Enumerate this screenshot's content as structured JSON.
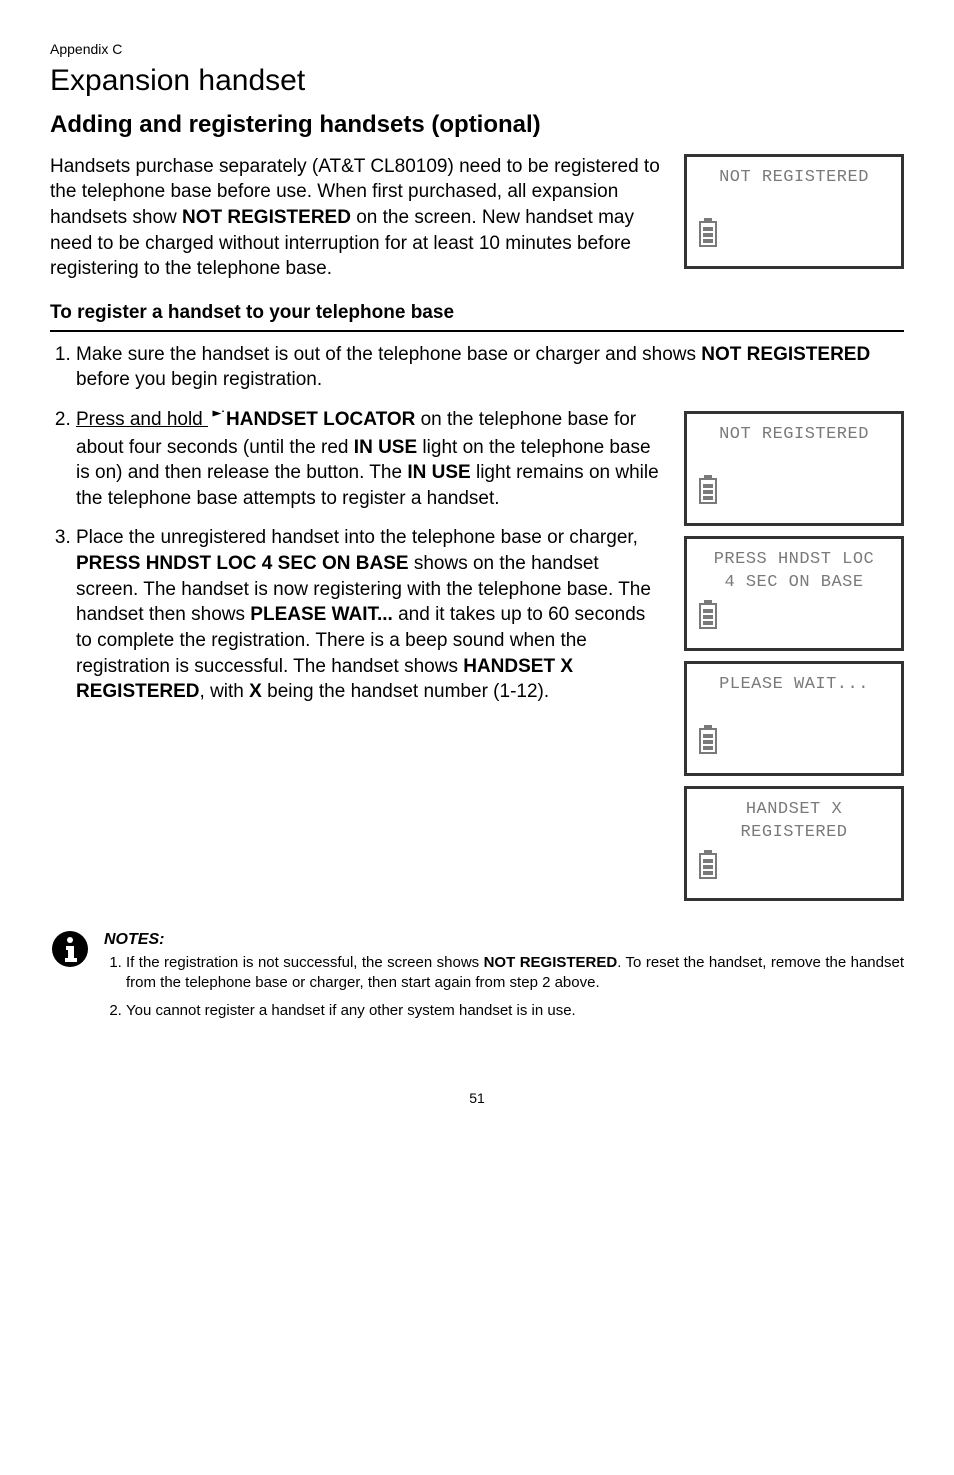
{
  "appendix_label": "Appendix C",
  "section_heading": "Expansion handset",
  "subheading": "Adding and registering handsets (optional)",
  "intro_text": "Handsets purchase separately (AT&T CL80109) need to be registered to the telephone base before use. When first purchased, all expansion handsets show ",
  "intro_bold": "NOT REGISTERED",
  "intro_tail": " on the screen. New handset may need to be charged without interruption for at least 10 minutes before registering to the telephone base.",
  "sub3": "To register a handset to your telephone base",
  "steps": {
    "s1a": "Make sure the handset is out of the telephone base or charger and shows ",
    "s1b": "NOT REGISTERED",
    "s1c": " before you begin registration.",
    "s2a": "Press and hold ",
    "s2b": "HANDSET LOCATOR",
    "s2c": " on the telephone base for about four seconds (until the red ",
    "s2d": "IN USE",
    "s2e": " light on the telephone base is on) and then release the button. The ",
    "s2f": "IN USE",
    "s2g": " light remains on while the telephone base attempts to register a handset.",
    "s3a": "Place the unregistered handset into the telephone base or charger, ",
    "s3b": "PRESS HNDST LOC 4 SEC ON BASE",
    "s3c": " shows on the handset screen. The handset is now registering with the telephone base. The handset then shows ",
    "s3d": "PLEASE WAIT...",
    "s3e": " and it takes up to 60 seconds to complete the registration. There is a beep sound when the registration is successful. The handset shows ",
    "s3f": "HANDSET X REGISTERED",
    "s3g": ", with ",
    "s3h": "X",
    "s3i": " being the handset number (1-12)."
  },
  "screens": {
    "not_registered": "NOT REGISTERED",
    "press_l1": "PRESS HNDST LOC",
    "press_l2": "4 SEC ON BASE",
    "please_wait": "PLEASE WAIT...",
    "handset_x": "HANDSET X",
    "registered": "REGISTERED"
  },
  "notes_label": "NOTES:",
  "notes": {
    "n1a": "If the registration is not successful, the screen shows ",
    "n1b": "NOT REGISTERED",
    "n1c": ". To reset the handset, remove the handset from the telephone base or charger, then start again from step 2 above.",
    "n2": "You cannot register a handset if any other system handset is in use."
  },
  "page_number": "51"
}
